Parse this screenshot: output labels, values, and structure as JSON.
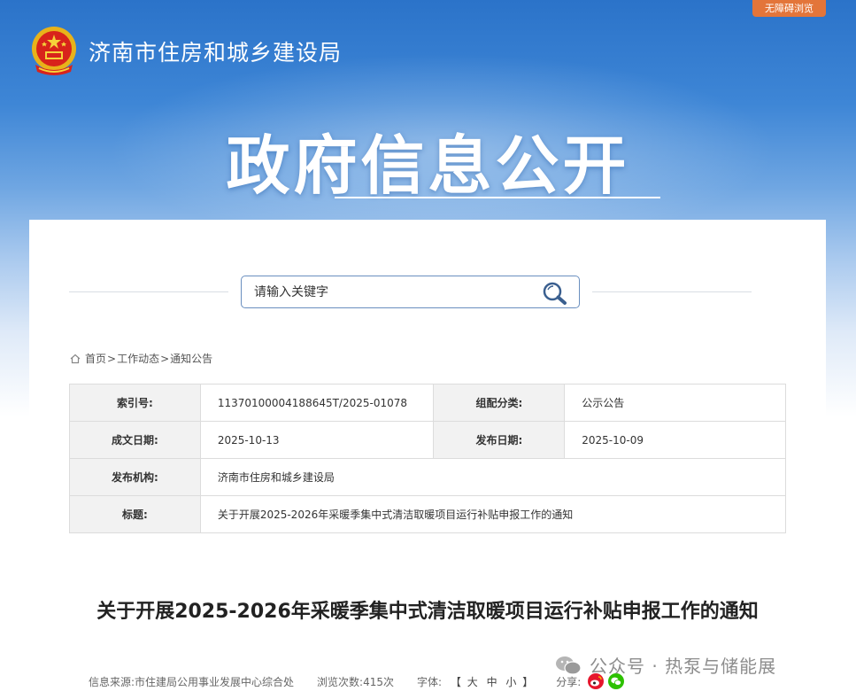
{
  "header": {
    "accessibility_label": "无障碍浏览",
    "site_name": "济南市住房和城乡建设局",
    "hero_title": "政府信息公开"
  },
  "search": {
    "placeholder": "请输入关键字"
  },
  "breadcrumb": {
    "items": [
      "首页",
      "工作动态",
      "通知公告"
    ],
    "separator": ">"
  },
  "meta": {
    "index_label": "索引号:",
    "index_value": "11370100004188645T/2025-01078",
    "category_label": "组配分类:",
    "category_value": "公示公告",
    "written_date_label": "成文日期:",
    "written_date_value": "2025-10-13",
    "publish_date_label": "发布日期:",
    "publish_date_value": "2025-10-09",
    "agency_label": "发布机构:",
    "agency_value": "济南市住房和城乡建设局",
    "title_label": "标题:",
    "title_value": "关于开展2025-2026年采暖季集中式清洁取暖项目运行补贴申报工作的通知"
  },
  "article": {
    "title": "关于开展2025-2026年采暖季集中式清洁取暖项目运行补贴申报工作的通知"
  },
  "info_bar": {
    "source": "信息来源:市住建局公用事业发展中心综合处",
    "views": "浏览次数:415次",
    "font_label": "字体:",
    "font_open": "【",
    "font_large": "大",
    "font_medium": "中",
    "font_small": "小",
    "font_close": "】",
    "share_label": "分享:"
  },
  "watermark": {
    "text": "公众号 · 热泵与储能展"
  },
  "colors": {
    "banner_top": "#2b73c9",
    "accent_orange": "#e3753a",
    "table_label_bg": "#f2f2f2",
    "weibo": "#e6162d",
    "wechat": "#2dc100"
  },
  "icons": [
    "national-emblem-icon",
    "search-icon",
    "home-icon",
    "weibo-icon",
    "wechat-icon",
    "wechat-official-account-icon"
  ]
}
